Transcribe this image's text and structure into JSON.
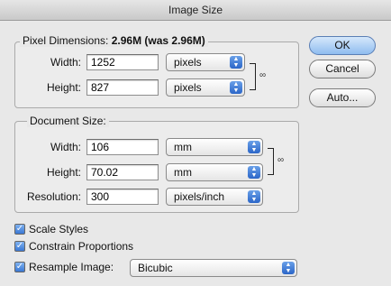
{
  "window": {
    "title": "Image Size"
  },
  "pixel_dimensions": {
    "legend": "Pixel Dimensions:",
    "summary": "2.96M (was 2.96M)",
    "width_label": "Width:",
    "width_value": "1252",
    "width_unit": "pixels",
    "height_label": "Height:",
    "height_value": "827",
    "height_unit": "pixels"
  },
  "document_size": {
    "legend": "Document Size:",
    "width_label": "Width:",
    "width_value": "106",
    "width_unit": "mm",
    "height_label": "Height:",
    "height_value": "70.02",
    "height_unit": "mm",
    "resolution_label": "Resolution:",
    "resolution_value": "300",
    "resolution_unit": "pixels/inch"
  },
  "buttons": {
    "ok": "OK",
    "cancel": "Cancel",
    "auto": "Auto..."
  },
  "options": {
    "scale_styles": {
      "label": "Scale Styles",
      "checked": true
    },
    "constrain_proportions": {
      "label": "Constrain Proportions",
      "checked": true
    },
    "resample_image": {
      "label": "Resample Image:",
      "checked": true,
      "method": "Bicubic"
    }
  },
  "icons": {
    "chain": "chain-link-icon",
    "arrow": "up-down-arrows-icon",
    "check": "checkmark-icon"
  },
  "colors": {
    "accent": "#3a78d4",
    "default_button": "#8fbcef",
    "background": "#e8e8e8"
  }
}
